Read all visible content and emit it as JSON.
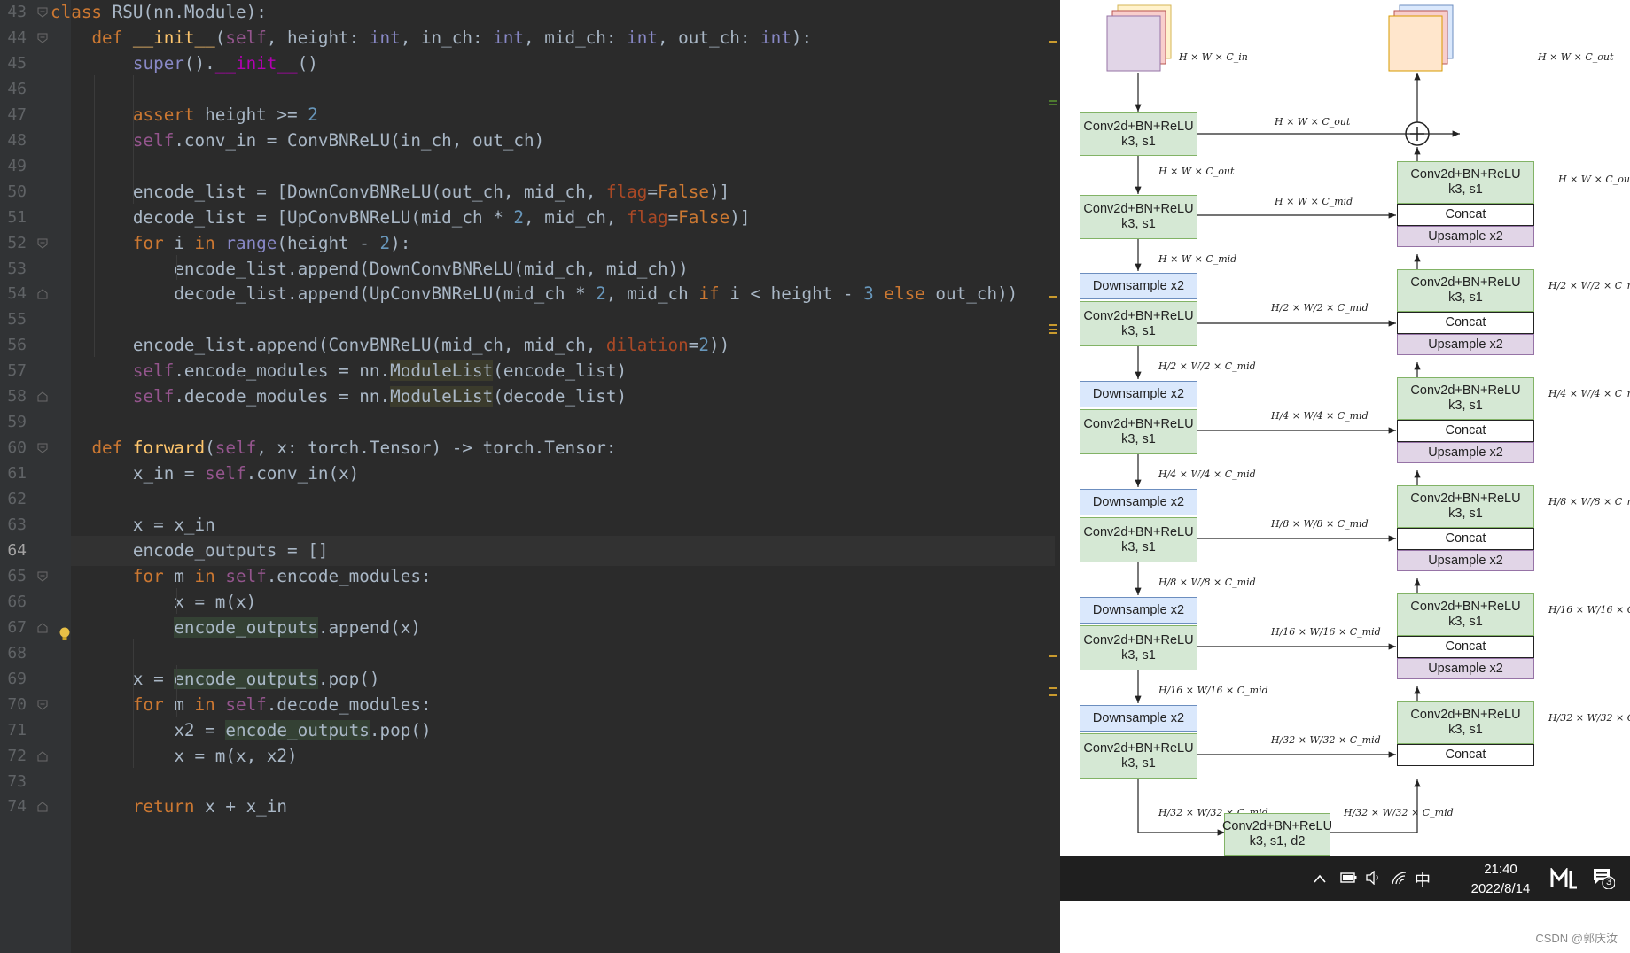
{
  "editor": {
    "current_line": "64",
    "lines": [
      {
        "n": "43",
        "text": "class RSU(nn.Module):"
      },
      {
        "n": "44",
        "text": "    def __init__(self, height: int, in_ch: int, mid_ch: int, out_ch: int):"
      },
      {
        "n": "45",
        "text": "        super().__init__()"
      },
      {
        "n": "46",
        "text": ""
      },
      {
        "n": "47",
        "text": "        assert height >= 2"
      },
      {
        "n": "48",
        "text": "        self.conv_in = ConvBNReLU(in_ch, out_ch)"
      },
      {
        "n": "49",
        "text": ""
      },
      {
        "n": "50",
        "text": "        encode_list = [DownConvBNReLU(out_ch, mid_ch, flag=False)]"
      },
      {
        "n": "51",
        "text": "        decode_list = [UpConvBNReLU(mid_ch * 2, mid_ch, flag=False)]"
      },
      {
        "n": "52",
        "text": "        for i in range(height - 2):"
      },
      {
        "n": "53",
        "text": "            encode_list.append(DownConvBNReLU(mid_ch, mid_ch))"
      },
      {
        "n": "54",
        "text": "            decode_list.append(UpConvBNReLU(mid_ch * 2, mid_ch if i < height - 3 else out_ch))"
      },
      {
        "n": "55",
        "text": ""
      },
      {
        "n": "56",
        "text": "        encode_list.append(ConvBNReLU(mid_ch, mid_ch, dilation=2))"
      },
      {
        "n": "57",
        "text": "        self.encode_modules = nn.ModuleList(encode_list)"
      },
      {
        "n": "58",
        "text": "        self.decode_modules = nn.ModuleList(decode_list)"
      },
      {
        "n": "59",
        "text": ""
      },
      {
        "n": "60",
        "text": "    def forward(self, x: torch.Tensor) -> torch.Tensor:"
      },
      {
        "n": "61",
        "text": "        x_in = self.conv_in(x)"
      },
      {
        "n": "62",
        "text": ""
      },
      {
        "n": "63",
        "text": "        x = x_in"
      },
      {
        "n": "64",
        "text": "        encode_outputs = []"
      },
      {
        "n": "65",
        "text": "        for m in self.encode_modules:"
      },
      {
        "n": "66",
        "text": "            x = m(x)"
      },
      {
        "n": "67",
        "text": "            encode_outputs.append(x)"
      },
      {
        "n": "68",
        "text": ""
      },
      {
        "n": "69",
        "text": "        x = encode_outputs.pop()"
      },
      {
        "n": "70",
        "text": "        for m in self.decode_modules:"
      },
      {
        "n": "71",
        "text": "            x2 = encode_outputs.pop()"
      },
      {
        "n": "72",
        "text": "            x = m(x, x2)"
      },
      {
        "n": "73",
        "text": ""
      },
      {
        "n": "74",
        "text": "        return x + x_in"
      }
    ]
  },
  "diagram": {
    "conv_label_1": "Conv2d+BN+ReLU",
    "conv_label_2": "k3, s1",
    "bottom_label_2": "k3, s1, d2",
    "downsample": "Downsample x2",
    "upsample": "Upsample x2",
    "concat": "Concat",
    "dims": {
      "in": "H × W × C_in",
      "out": "H × W × C_out",
      "mid": "H × W × C_mid",
      "d2": "H/2 × W/2 × C_mid",
      "d4": "H/4 × W/4 × C_mid",
      "d8": "H/8 × W/8 × C_mid",
      "d16": "H/16 × W/16 × C_mid",
      "d32": "H/32 × W/32 × C_mid"
    }
  },
  "taskbar": {
    "ime": "中",
    "time": "21:40",
    "date": "2022/8/14",
    "notification_count": "3"
  },
  "watermark": "CSDN @郭庆汝"
}
